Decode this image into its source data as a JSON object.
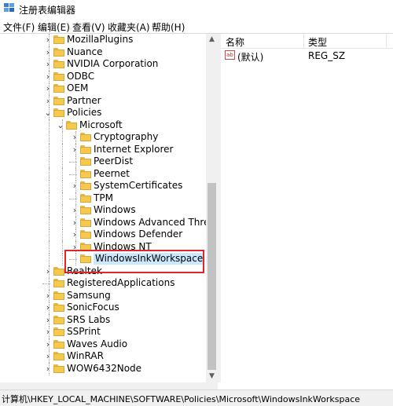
{
  "window": {
    "title": "注册表编辑器"
  },
  "menu": [
    "文件(F)",
    "编辑(E)",
    "查看(V)",
    "收藏夹(A)",
    "帮助(H)"
  ],
  "tree": {
    "items": [
      {
        "label": "MozillaPlugins",
        "level": 1,
        "expander": "collapsed"
      },
      {
        "label": "Nuance",
        "level": 1,
        "expander": "collapsed"
      },
      {
        "label": "NVIDIA Corporation",
        "level": 1,
        "expander": "collapsed"
      },
      {
        "label": "ODBC",
        "level": 1,
        "expander": "collapsed"
      },
      {
        "label": "OEM",
        "level": 1,
        "expander": "collapsed"
      },
      {
        "label": "Partner",
        "level": 1,
        "expander": "collapsed"
      },
      {
        "label": "Policies",
        "level": 1,
        "expander": "expanded"
      },
      {
        "label": "Microsoft",
        "level": 2,
        "expander": "expanded"
      },
      {
        "label": "Cryptography",
        "level": 3,
        "expander": "collapsed"
      },
      {
        "label": "Internet Explorer",
        "level": 3,
        "expander": "collapsed"
      },
      {
        "label": "PeerDist",
        "level": 3,
        "expander": "none"
      },
      {
        "label": "Peernet",
        "level": 3,
        "expander": "none"
      },
      {
        "label": "SystemCertificates",
        "level": 3,
        "expander": "collapsed"
      },
      {
        "label": "TPM",
        "level": 3,
        "expander": "none"
      },
      {
        "label": "Windows",
        "level": 3,
        "expander": "collapsed"
      },
      {
        "label": "Windows Advanced Threat P",
        "level": 3,
        "expander": "collapsed"
      },
      {
        "label": "Windows Defender",
        "level": 3,
        "expander": "collapsed"
      },
      {
        "label": "Windows NT",
        "level": 3,
        "expander": "collapsed"
      },
      {
        "label": "WindowsInkWorkspace",
        "level": 3,
        "expander": "none",
        "selected": true
      },
      {
        "label": "Realtek",
        "level": 1,
        "expander": "collapsed"
      },
      {
        "label": "RegisteredApplications",
        "level": 1,
        "expander": "none"
      },
      {
        "label": "Samsung",
        "level": 1,
        "expander": "collapsed"
      },
      {
        "label": "SonicFocus",
        "level": 1,
        "expander": "collapsed"
      },
      {
        "label": "SRS Labs",
        "level": 1,
        "expander": "collapsed"
      },
      {
        "label": "SSPrint",
        "level": 1,
        "expander": "collapsed"
      },
      {
        "label": "Waves Audio",
        "level": 1,
        "expander": "collapsed"
      },
      {
        "label": "WinRAR",
        "level": 1,
        "expander": "collapsed"
      },
      {
        "label": "WOW6432Node",
        "level": 1,
        "expander": "collapsed"
      }
    ]
  },
  "list": {
    "headers": {
      "name": "名称",
      "type": "类型"
    },
    "rows": [
      {
        "icon": "ab",
        "name": "(默认)",
        "type": "REG_SZ"
      }
    ]
  },
  "status_bar": {
    "path": "计算机\\HKEY_LOCAL_MACHINE\\SOFTWARE\\Policies\\Microsoft\\WindowsInkWorkspace"
  },
  "colors": {
    "selection": "#cce8ff",
    "folder": "#f4c94d",
    "highlight_box": "#e0242b"
  }
}
